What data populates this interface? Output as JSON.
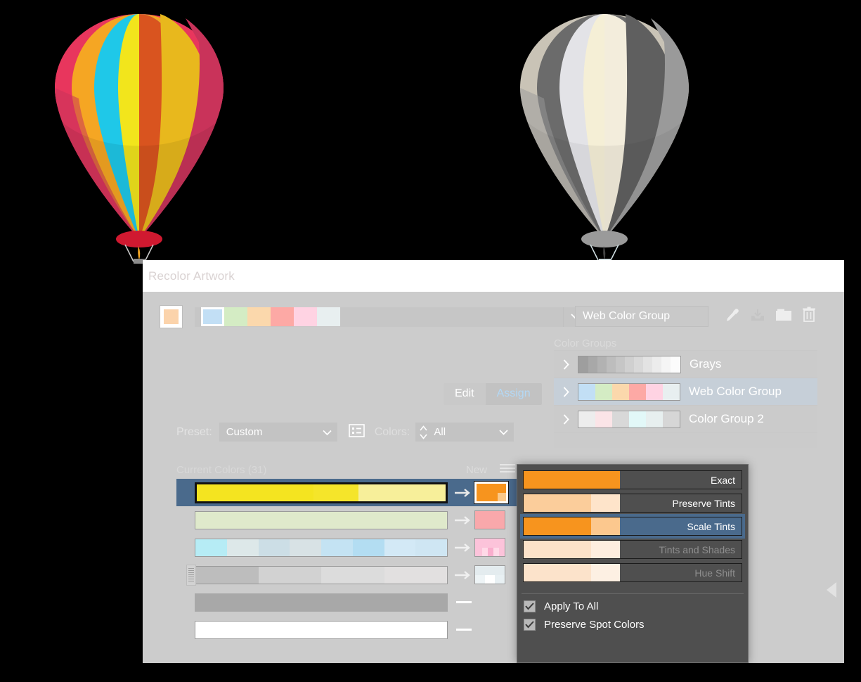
{
  "window": {
    "title": "Recolor Artwork"
  },
  "header": {
    "active_color_swatch": "#fbd3ab",
    "palette_strip": [
      "#c2dff5",
      "#d4ecc4",
      "#fbd8ac",
      "#fda9a5",
      "#ffd3e3",
      "#e8eff0"
    ],
    "dropdown_caret_icon": "chevron-down-icon"
  },
  "tabs": [
    {
      "label": "Edit",
      "active": false
    },
    {
      "label": "Assign",
      "active": true
    }
  ],
  "controls": {
    "preset_label": "Preset:",
    "preset_value": "Custom",
    "colors_label": "Colors:",
    "colors_value": "All",
    "list_icon": "list-options-icon",
    "spinner_icon": "stepper-icon"
  },
  "current_colors": {
    "title": "Current Colors (31)",
    "new_label": "New",
    "menu_icon": "hamburger-menu-icon",
    "rows": [
      {
        "selected": true,
        "source": [
          "#f4e420",
          "#f5e52a",
          "#f7ef9a"
        ],
        "dest_top": [
          "#f7941e"
        ],
        "dest_bottom": [
          "#f7941e",
          "#f7941e",
          "#fbc98a"
        ],
        "has_arrow": true
      },
      {
        "selected": false,
        "source": [
          "#dfe9cb"
        ],
        "dest_top": [
          "#f9a8ab"
        ],
        "dest_bottom": [
          "#f9a8ab"
        ],
        "has_arrow": true
      },
      {
        "selected": false,
        "source": [
          "#b6ecf5",
          "#dde8e9",
          "#ccdee6",
          "#d8e2e5",
          "#c4e3f3",
          "#b3ddf2",
          "#d3e9f6",
          "#cfe6f3"
        ],
        "dest_top": [
          "#fcc3da"
        ],
        "dest_bottom": [
          "#fcc3da",
          "#ffd9e7",
          "#f9aecd",
          "#ffd9e7",
          "#fcc3da"
        ],
        "has_arrow": true
      },
      {
        "selected": false,
        "source": [
          "#bdbdbd",
          "#d2d2d2",
          "#dcdcdc",
          "#e2e0e0"
        ],
        "dest_top": [
          "#e4ecef"
        ],
        "dest_bottom": [
          "#eef4f6",
          "#ffffff",
          "#e8f0f3"
        ],
        "has_arrow": true,
        "has_grip": true,
        "has_down_button": true
      },
      {
        "selected": false,
        "source": [
          "#a8a8a8"
        ],
        "has_arrow": false
      },
      {
        "selected": false,
        "source": [
          "#ffffff"
        ],
        "has_arrow": false
      }
    ]
  },
  "color_group_panel": {
    "name_value": "Web Color Group",
    "tools": [
      {
        "icon": "eyedropper-icon",
        "disabled": false
      },
      {
        "icon": "save-download-icon",
        "disabled": true
      },
      {
        "icon": "folder-icon",
        "disabled": false
      },
      {
        "icon": "trash-icon",
        "disabled": false
      }
    ],
    "section_label": "Color Groups",
    "groups": [
      {
        "name": "Grays",
        "selected": false,
        "chevron_icon": "chevron-right-icon",
        "swatches": [
          "#9e9e9e",
          "#a8a8a8",
          "#b2b2b2",
          "#bdbdbd",
          "#c6c6c6",
          "#d0d0d0",
          "#d9d9d9",
          "#e3e3e3",
          "#ececec",
          "#f5f5f5",
          "#fcfcfc"
        ]
      },
      {
        "name": "Web Color Group",
        "selected": true,
        "chevron_icon": "chevron-right-icon",
        "swatches": [
          "#c2dff5",
          "#d4ecc4",
          "#fbd8ac",
          "#fda9a5",
          "#ffd3e3",
          "#e8eff0"
        ]
      },
      {
        "name": "Color Group 2",
        "selected": false,
        "chevron_icon": "chevron-right-icon",
        "swatches": [
          "#ededed",
          "#fbe4e7",
          "#d8d8d8",
          "#e2f8f8",
          "#e7efef",
          "#d6d6d6"
        ]
      }
    ]
  },
  "popup": {
    "options": [
      {
        "label": "Exact",
        "selected": false,
        "disabled": false,
        "swatches": [
          "#f7941e",
          "#f7941e"
        ]
      },
      {
        "label": "Preserve Tints",
        "selected": false,
        "disabled": false,
        "swatches": [
          "#fbcd9b",
          "#fbcd9b",
          "#fee4ca"
        ]
      },
      {
        "label": "Scale Tints",
        "selected": true,
        "disabled": false,
        "swatches": [
          "#f7941e",
          "#f7941e",
          "#fcc88e"
        ]
      },
      {
        "label": "Tints and Shades",
        "selected": false,
        "disabled": true,
        "swatches": [
          "#fce2c9",
          "#fce2c9",
          "#feeedf"
        ]
      },
      {
        "label": "Hue Shift",
        "selected": false,
        "disabled": true,
        "swatches": [
          "#fce3cb",
          "#fce3cb",
          "#fdf0e3"
        ]
      }
    ],
    "checkboxes": [
      {
        "label": "Apply To All",
        "checked": true
      },
      {
        "label": "Preserve Spot Colors",
        "checked": true
      }
    ]
  },
  "collapse_arrow": {
    "icon": "triangle-left-icon"
  },
  "artwork": {
    "color_balloon": {
      "name": "colored-hot-air-balloon",
      "panels": [
        "#e8365d",
        "#f5a623",
        "#1fc8e8",
        "#f2e51c",
        "#d9541f",
        "#e8b81d",
        "#c9335a"
      ],
      "basket_rim": "#d01930"
    },
    "gray_balloon": {
      "name": "grayscale-hot-air-balloon",
      "panels": [
        "#c9c3b6",
        "#6b6b6b",
        "#e3e3e7",
        "#f5efd6",
        "#f3eddc",
        "#5f5f5f",
        "#9a9a9a"
      ],
      "basket_rim": "#9a9a9a"
    }
  }
}
